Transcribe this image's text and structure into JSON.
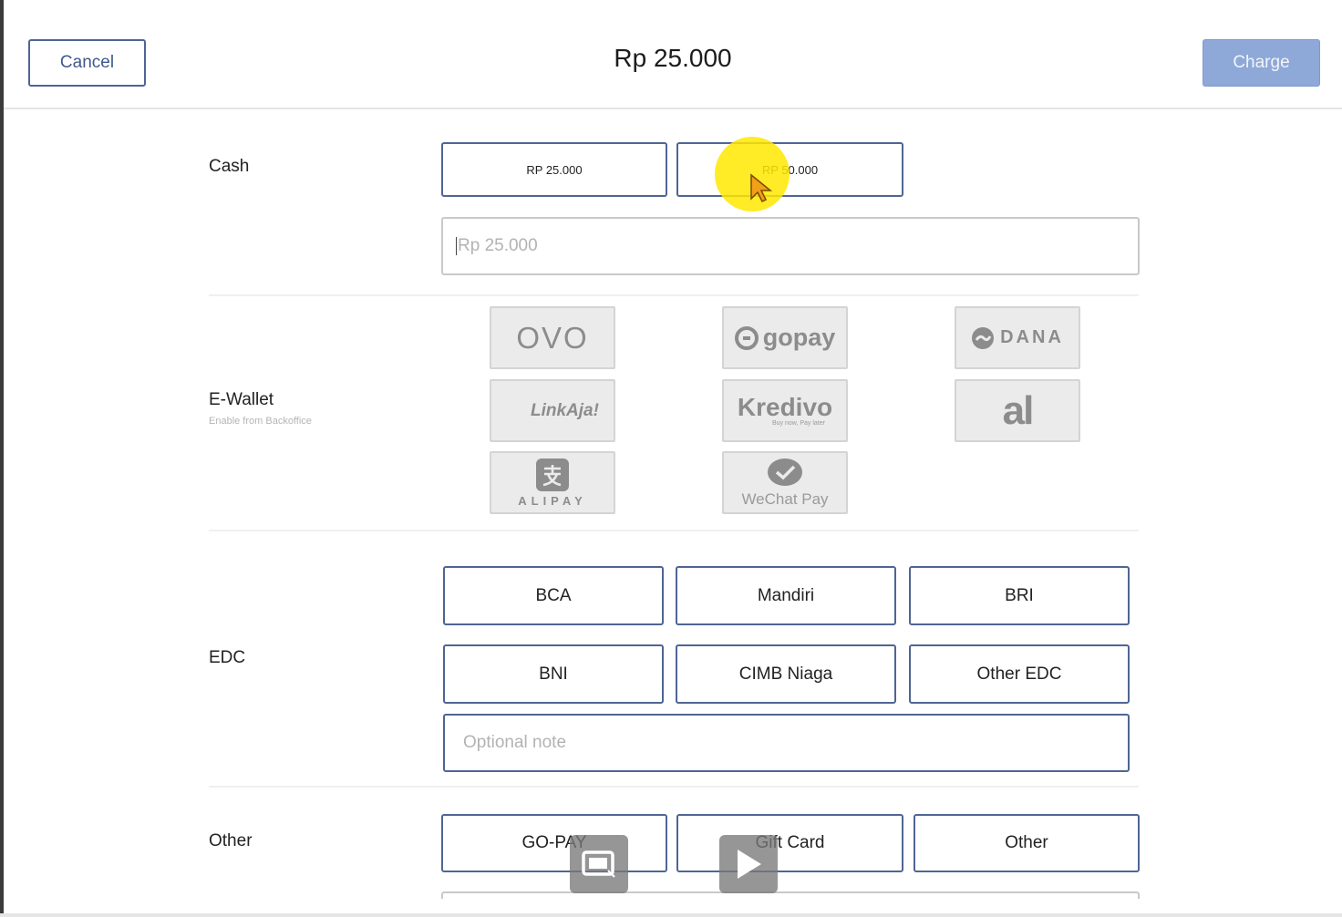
{
  "header": {
    "cancel_label": "Cancel",
    "amount": "Rp 25.000",
    "charge_label": "Charge"
  },
  "cash": {
    "label": "Cash",
    "quick_amounts": [
      "RP 25.000",
      "RP 50.000"
    ],
    "input_placeholder": "Rp 25.000"
  },
  "ewallet": {
    "label": "E-Wallet",
    "sublabel": "Enable from Backoffice",
    "providers": [
      {
        "name": "OVO",
        "icon": "ovo-logo-icon"
      },
      {
        "name": "gopay",
        "icon": "gopay-logo-icon"
      },
      {
        "name": "DANA",
        "icon": "dana-logo-icon"
      },
      {
        "name": "LinkAja!",
        "icon": "linkaja-logo-icon"
      },
      {
        "name": "Kredivo",
        "tagline": "Buy now, Pay later",
        "icon": "kredivo-logo-icon"
      },
      {
        "name": "al",
        "icon": "akulaku-logo-icon"
      },
      {
        "name": "ALIPAY",
        "icon": "alipay-logo-icon"
      },
      {
        "name": "WeChat Pay",
        "icon": "wechat-pay-logo-icon"
      }
    ]
  },
  "edc": {
    "label": "EDC",
    "banks": [
      "BCA",
      "Mandiri",
      "BRI",
      "BNI",
      "CIMB Niaga",
      "Other EDC"
    ],
    "note_placeholder": "Optional note"
  },
  "other": {
    "label": "Other",
    "options": [
      "GO-PAY",
      "Gift Card",
      "Other"
    ]
  },
  "overlay": {
    "screen_record_icon": "screen-record-icon",
    "play_icon": "play-icon",
    "cursor_highlight_color": "#FFE800"
  },
  "colors": {
    "accent": "#4F6594",
    "charge_bg": "#8EA8D8"
  }
}
